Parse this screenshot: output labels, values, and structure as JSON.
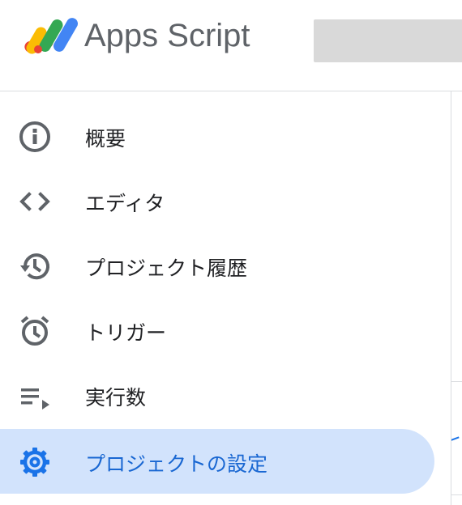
{
  "header": {
    "app_title": "Apps Script"
  },
  "sidebar": {
    "items": [
      {
        "label": "概要",
        "icon": "info-icon",
        "active": false
      },
      {
        "label": "エディタ",
        "icon": "code-icon",
        "active": false
      },
      {
        "label": "プロジェクト履歴",
        "icon": "history-icon",
        "active": false
      },
      {
        "label": "トリガー",
        "icon": "alarm-icon",
        "active": false
      },
      {
        "label": "実行数",
        "icon": "playlist-play-icon",
        "active": false
      },
      {
        "label": "プロジェクトの設定",
        "icon": "gear-icon",
        "active": true
      }
    ]
  },
  "colors": {
    "active_bg": "#d2e3fc",
    "active_text": "#1967d2",
    "icon_gray": "#5f6368",
    "icon_active": "#1a73e8"
  }
}
